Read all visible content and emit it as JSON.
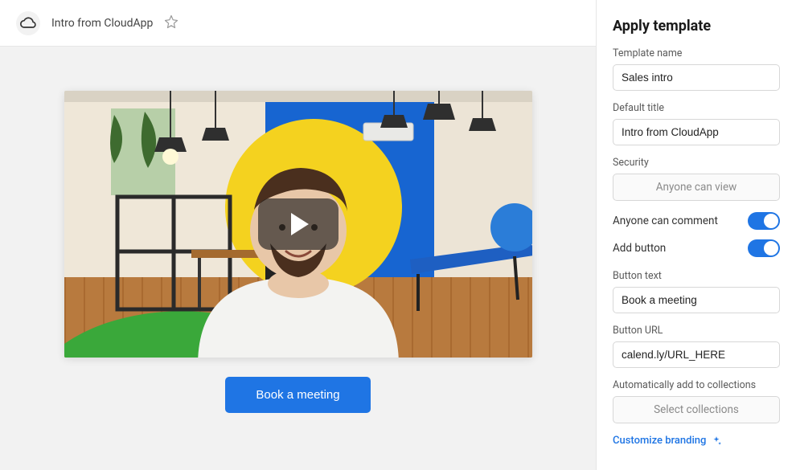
{
  "topbar": {
    "title": "Intro from CloudApp"
  },
  "preview": {
    "cta_label": "Book a meeting"
  },
  "panel": {
    "heading": "Apply template",
    "template_name_label": "Template name",
    "template_name_value": "Sales intro",
    "default_title_label": "Default title",
    "default_title_value": "Intro from CloudApp",
    "security_label": "Security",
    "security_value": "Anyone can view",
    "toggle_comment_label": "Anyone can comment",
    "toggle_comment_on": true,
    "toggle_addbutton_label": "Add button",
    "toggle_addbutton_on": true,
    "button_text_label": "Button text",
    "button_text_value": "Book a meeting",
    "button_url_label": "Button URL",
    "button_url_value": "calend.ly/URL_HERE",
    "collections_label": "Automatically add to collections",
    "collections_placeholder": "Select collections",
    "customize_branding_label": "Customize branding"
  }
}
